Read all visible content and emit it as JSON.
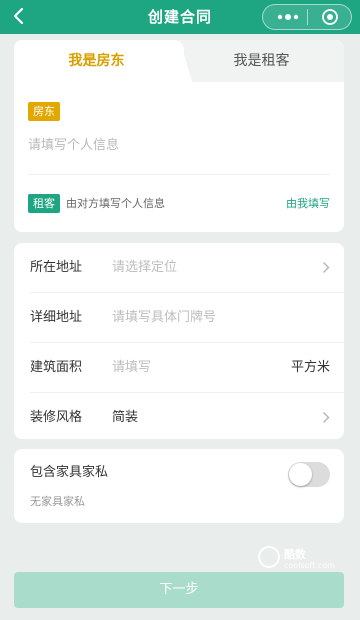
{
  "header": {
    "title": "创建合同",
    "background": "#1ea582"
  },
  "party": {
    "tabs": [
      {
        "label": "我是房东",
        "active": true
      },
      {
        "label": "我是租客",
        "active": false
      }
    ],
    "landlord_tag": "房东",
    "landlord_placeholder": "请填写个人信息",
    "tenant_tag": "租客",
    "tenant_desc": "由对方填写个人信息",
    "fill_mine": "由我填写"
  },
  "address": {
    "rows": [
      {
        "label": "所在地址",
        "value": "请选择定位"
      },
      {
        "label": "详细地址",
        "value": "请填写具体门牌号"
      },
      {
        "label": "建筑面积",
        "value": "请填写",
        "unit": "平方米"
      },
      {
        "label": "装修风格",
        "value": "简装"
      }
    ]
  },
  "furniture": {
    "label": "包含家具家私",
    "sub": "无家具家私",
    "enabled": false
  },
  "footer": {
    "next_label": "下一步"
  },
  "watermark": {
    "name": "酷数",
    "url": "coolsoft.com"
  },
  "colors": {
    "accent": "#1ea582",
    "landlord": "#e0a800"
  }
}
